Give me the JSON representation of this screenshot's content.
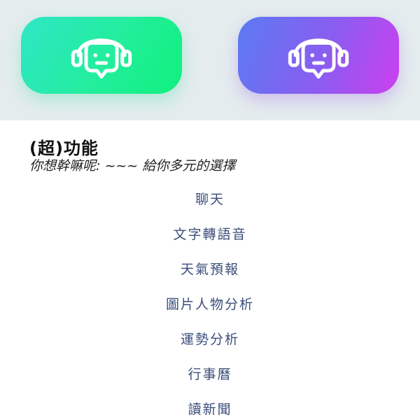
{
  "hero": {
    "icons": [
      {
        "name": "chatbot-icon",
        "color_from": "#2fe6c6",
        "color_to": "#10f07c"
      },
      {
        "name": "chatbot-icon",
        "color_from": "#5a7bf2",
        "color_to": "#cc3ff0"
      }
    ]
  },
  "section": {
    "title": "(超)功能",
    "subtitle": "你想幹嘛呢: ~~~ 給你多元的選擇"
  },
  "menu": {
    "items": [
      {
        "label": "聊天"
      },
      {
        "label": "文字轉語音"
      },
      {
        "label": "天氣預報"
      },
      {
        "label": "圖片人物分析"
      },
      {
        "label": "運勢分析"
      },
      {
        "label": "行事曆"
      },
      {
        "label": "讀新聞"
      }
    ],
    "text_color": "#3b4e7a"
  }
}
